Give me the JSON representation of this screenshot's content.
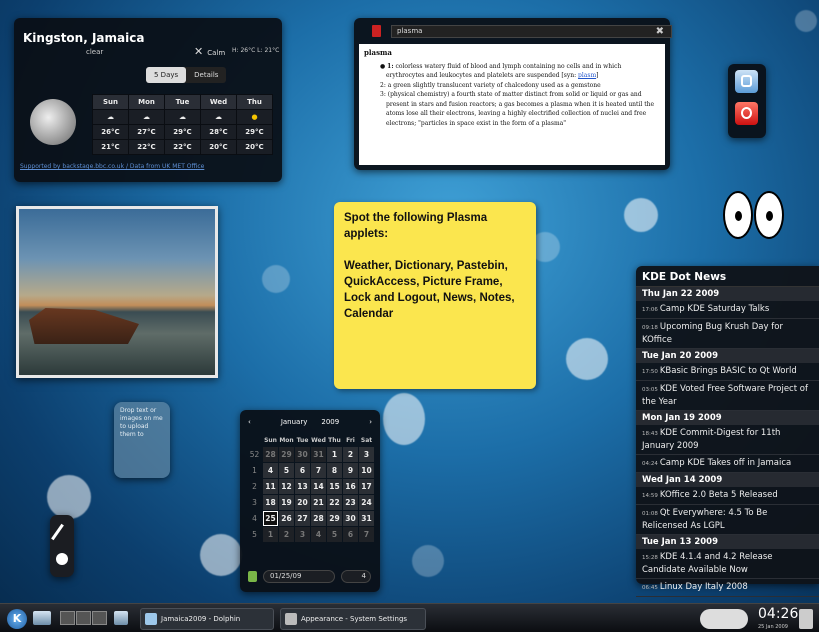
{
  "weather": {
    "city": "Kingston, Jamaica",
    "condition": "clear",
    "wind": "Calm",
    "hilo": "H: 26°C L: 21°C",
    "tabs": [
      "5 Days",
      "Details"
    ],
    "days": [
      "Sun",
      "Mon",
      "Tue",
      "Wed",
      "Thu"
    ],
    "highs": [
      "26°C",
      "27°C",
      "29°C",
      "28°C",
      "29°C"
    ],
    "lows": [
      "21°C",
      "22°C",
      "22°C",
      "20°C",
      "20°C"
    ],
    "support": "Supported by backstage.bbc.co.uk / Data from UK MET Office"
  },
  "dictionary": {
    "query": "plasma",
    "word": "plasma",
    "def1a": "1:",
    "def1": "colorless watery fluid of blood and lymph containing no cells and in which erythrocytes and leukocytes and platelets are suspended [syn:",
    "def1link": "plasm",
    "def1end": "]",
    "def2": "2: a green slightly translucent variety of chalcedony used as a gemstone",
    "def3": "3: (physical chemistry) a fourth state of matter distinct from solid or liquid or gas and present in stars and fusion reactors; a gas becomes a plasma when it is heated until the atoms lose all their electrons, leaving a highly electrified collection of nuclei and free electrons; \"particles in space exist in the form of a plasma\""
  },
  "note": {
    "text": "Spot the following Plasma applets:\n\nWeather, Dictionary, Pastebin, QuickAccess, Picture Frame, Lock and Logout, News, Notes, Calendar"
  },
  "pastebin": {
    "text": "Drop text or images on me to upload them to"
  },
  "calendar": {
    "month": "January",
    "year": "2009",
    "prev": "‹",
    "next": "›",
    "headers": [
      "Sun",
      "Mon",
      "Tue",
      "Wed",
      "Thu",
      "Fri",
      "Sat"
    ],
    "weeks": [
      {
        "wk": "52",
        "days": [
          "28",
          "29",
          "30",
          "31",
          "1",
          "2",
          "3"
        ]
      },
      {
        "wk": "1",
        "days": [
          "4",
          "5",
          "6",
          "7",
          "8",
          "9",
          "10"
        ]
      },
      {
        "wk": "2",
        "days": [
          "11",
          "12",
          "13",
          "14",
          "15",
          "16",
          "17"
        ]
      },
      {
        "wk": "3",
        "days": [
          "18",
          "19",
          "20",
          "21",
          "22",
          "23",
          "24"
        ]
      },
      {
        "wk": "4",
        "days": [
          "25",
          "26",
          "27",
          "28",
          "29",
          "30",
          "31"
        ]
      },
      {
        "wk": "5",
        "days": [
          "1",
          "2",
          "3",
          "4",
          "5",
          "6",
          "7"
        ]
      }
    ],
    "date_value": "01/25/09",
    "week_value": "4"
  },
  "news": {
    "title": "KDE Dot News",
    "items": [
      {
        "kind": "date",
        "text": "Thu Jan 22 2009"
      },
      {
        "kind": "item",
        "time": "17:06",
        "text": "Camp KDE Saturday Talks"
      },
      {
        "kind": "item",
        "time": "09:18",
        "text": "Upcoming Bug Krush Day for KOffice"
      },
      {
        "kind": "date",
        "text": "Tue Jan 20 2009"
      },
      {
        "kind": "item",
        "time": "17:50",
        "text": "KBasic Brings BASIC to Qt World"
      },
      {
        "kind": "item",
        "time": "03:05",
        "text": "KDE Voted Free Software Project of the Year"
      },
      {
        "kind": "date",
        "text": "Mon Jan 19 2009"
      },
      {
        "kind": "item",
        "time": "18:43",
        "text": "KDE Commit-Digest for 11th January 2009"
      },
      {
        "kind": "item",
        "time": "04:24",
        "text": "Camp KDE Takes off in Jamaica"
      },
      {
        "kind": "date",
        "text": "Wed Jan 14 2009"
      },
      {
        "kind": "item",
        "time": "14:59",
        "text": "KOffice 2.0 Beta 5 Released"
      },
      {
        "kind": "item",
        "time": "01:08",
        "text": "Qt Everywhere: 4.5 To Be Relicensed As LGPL"
      },
      {
        "kind": "date",
        "text": "Tue Jan 13 2009"
      },
      {
        "kind": "item",
        "time": "15:28",
        "text": "KDE 4.1.4 and 4.2 Release Candidate Available Now"
      },
      {
        "kind": "item",
        "time": "06:45",
        "text": "Linux Day Italy 2008"
      }
    ]
  },
  "taskbar": {
    "tasks": [
      "Jamaica2009 - Dolphin",
      "Appearance - System Settings"
    ],
    "clock": "04:26",
    "clock_date": "25 Jan 2009"
  }
}
